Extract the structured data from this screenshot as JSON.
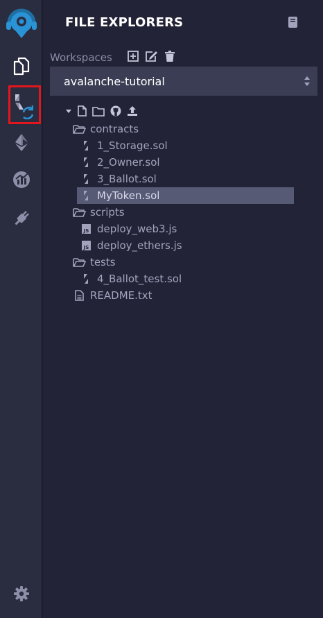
{
  "sidebar": {
    "title": "FILE EXPLORERS",
    "workspaces_label": "Workspaces",
    "workspace_selected": "avalanche-tutorial"
  },
  "tree": {
    "folders": {
      "contracts": "contracts",
      "scripts": "scripts",
      "tests": "tests"
    },
    "files": {
      "storage": "1_Storage.sol",
      "owner": "2_Owner.sol",
      "ballot": "3_Ballot.sol",
      "mytoken": "MyToken.sol",
      "deploy_web3": "deploy_web3.js",
      "deploy_ethers": "deploy_ethers.js",
      "ballot_test": "4_Ballot_test.sol",
      "readme": "README.txt"
    },
    "selected_file": "MyToken.sol"
  },
  "icons": {
    "logo": "remix-logo-icon",
    "files": "file-explorer-icon",
    "compiler": "solidity-compiler-icon",
    "deploy": "deploy-run-icon",
    "analysis": "analysis-icon",
    "plugin": "plugin-manager-icon",
    "settings": "gear-icon"
  },
  "colors": {
    "background": "#222336",
    "icon_panel": "#2a2c3f",
    "selected_row": "#575a75",
    "select_box": "#3b3d54",
    "highlight_box": "#e4161d",
    "accent_blue": "#2a93d5"
  }
}
